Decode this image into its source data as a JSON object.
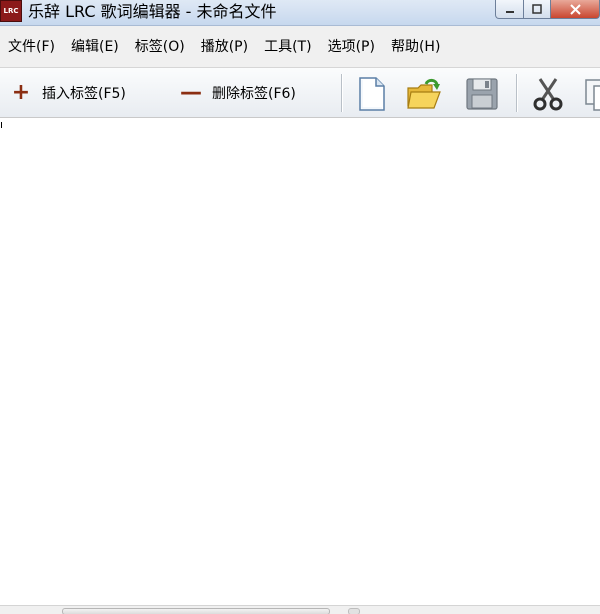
{
  "window": {
    "app_icon_text": "LRC",
    "title": "乐辞 LRC 歌词编辑器 - 未命名文件"
  },
  "menu": [
    {
      "label": "文件(F)"
    },
    {
      "label": "编辑(E)"
    },
    {
      "label": "标签(O)"
    },
    {
      "label": "播放(P)"
    },
    {
      "label": "工具(T)"
    },
    {
      "label": "选项(P)"
    },
    {
      "label": "帮助(H)"
    }
  ],
  "toolbar": {
    "insert_tag": {
      "glyph": "+",
      "label": "插入标签(F5)"
    },
    "delete_tag": {
      "glyph": "—",
      "label": "删除标签(F6)"
    },
    "icons": [
      "new-file-icon",
      "open-folder-icon",
      "save-icon",
      "cut-icon",
      "copy-icon"
    ]
  },
  "editor": {
    "content": ""
  },
  "colors": {
    "titlebar": "#c7d8ee",
    "close_button": "#c9462f",
    "tag_glyph": "#8b2e12",
    "app_icon": "#8b1a1a"
  }
}
